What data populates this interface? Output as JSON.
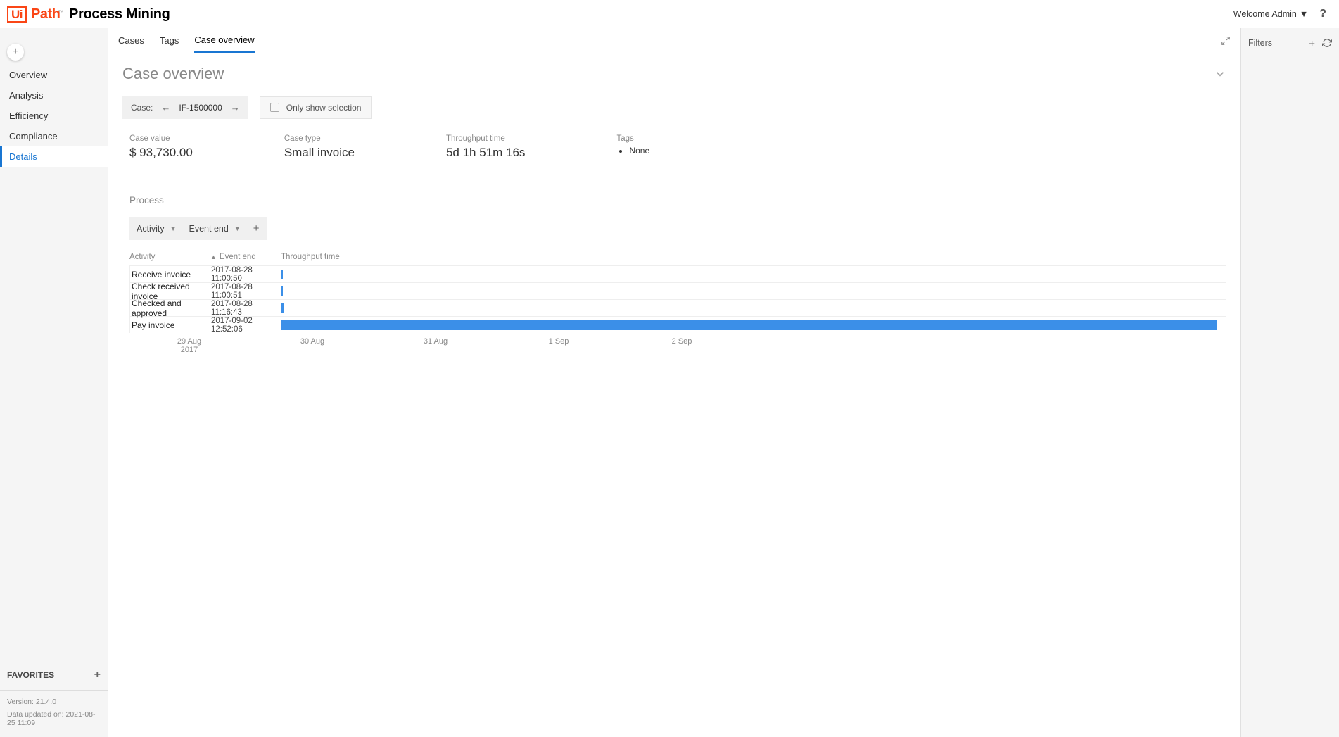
{
  "topbar": {
    "logo_ui": "Ui",
    "logo_path": "Path",
    "logo_tm": "™",
    "logo_pm": "Process Mining",
    "welcome": "Welcome Admin"
  },
  "sidebar": {
    "items": [
      {
        "label": "Overview"
      },
      {
        "label": "Analysis"
      },
      {
        "label": "Efficiency"
      },
      {
        "label": "Compliance"
      },
      {
        "label": "Details"
      }
    ],
    "favorites_label": "FAVORITES",
    "version_label": "Version: 21.4.0",
    "data_updated_label": "Data updated on: 2021-08-25 11:09"
  },
  "tabs": {
    "items": [
      {
        "label": "Cases"
      },
      {
        "label": "Tags"
      },
      {
        "label": "Case overview"
      }
    ]
  },
  "page": {
    "title": "Case overview",
    "case_label": "Case:",
    "case_id": "IF-1500000",
    "only_show_label": "Only show selection",
    "stats": {
      "case_value_label": "Case value",
      "case_value": "$ 93,730.00",
      "case_type_label": "Case type",
      "case_type": "Small invoice",
      "throughput_label": "Throughput time",
      "throughput": "5d 1h 51m 16s",
      "tags_label": "Tags",
      "tags_none": "None"
    },
    "process_title": "Process",
    "dropdown_activity": "Activity",
    "dropdown_eventend": "Event end",
    "table": {
      "col_activity": "Activity",
      "col_eventend": "Event end",
      "col_throughput": "Throughput time",
      "rows": [
        {
          "activity": "Receive invoice",
          "event_end": "2017-08-28 11:00:50"
        },
        {
          "activity": "Check received invoice",
          "event_end": "2017-08-28 11:00:51"
        },
        {
          "activity": "Checked and approved",
          "event_end": "2017-08-28 11:16:43"
        },
        {
          "activity": "Pay invoice",
          "event_end": "2017-09-02 12:52:06"
        }
      ],
      "axis": [
        "29 Aug",
        "30 Aug",
        "31 Aug",
        "1 Sep",
        "2 Sep"
      ],
      "axis_year": "2017"
    }
  },
  "filters": {
    "title": "Filters"
  },
  "chart_data": {
    "type": "bar",
    "orientation": "horizontal-gantt",
    "x_axis": {
      "ticks": [
        "29 Aug 2017",
        "30 Aug 2017",
        "31 Aug 2017",
        "1 Sep 2017",
        "2 Sep 2017"
      ],
      "range_start": "2017-08-28 11:00:50",
      "range_end": "2017-09-02 12:52:06"
    },
    "series": [
      {
        "name": "Receive invoice",
        "start": "2017-08-28 11:00:50",
        "end": "2017-08-28 11:00:50",
        "duration_pct": 0.1
      },
      {
        "name": "Check received invoice",
        "start": "2017-08-28 11:00:50",
        "end": "2017-08-28 11:00:51",
        "duration_pct": 0.1
      },
      {
        "name": "Checked and approved",
        "start": "2017-08-28 11:00:51",
        "end": "2017-08-28 11:16:43",
        "duration_pct": 0.3
      },
      {
        "name": "Pay invoice",
        "start": "2017-08-28 11:16:43",
        "end": "2017-09-02 12:52:06",
        "duration_pct": 99.5
      }
    ]
  }
}
